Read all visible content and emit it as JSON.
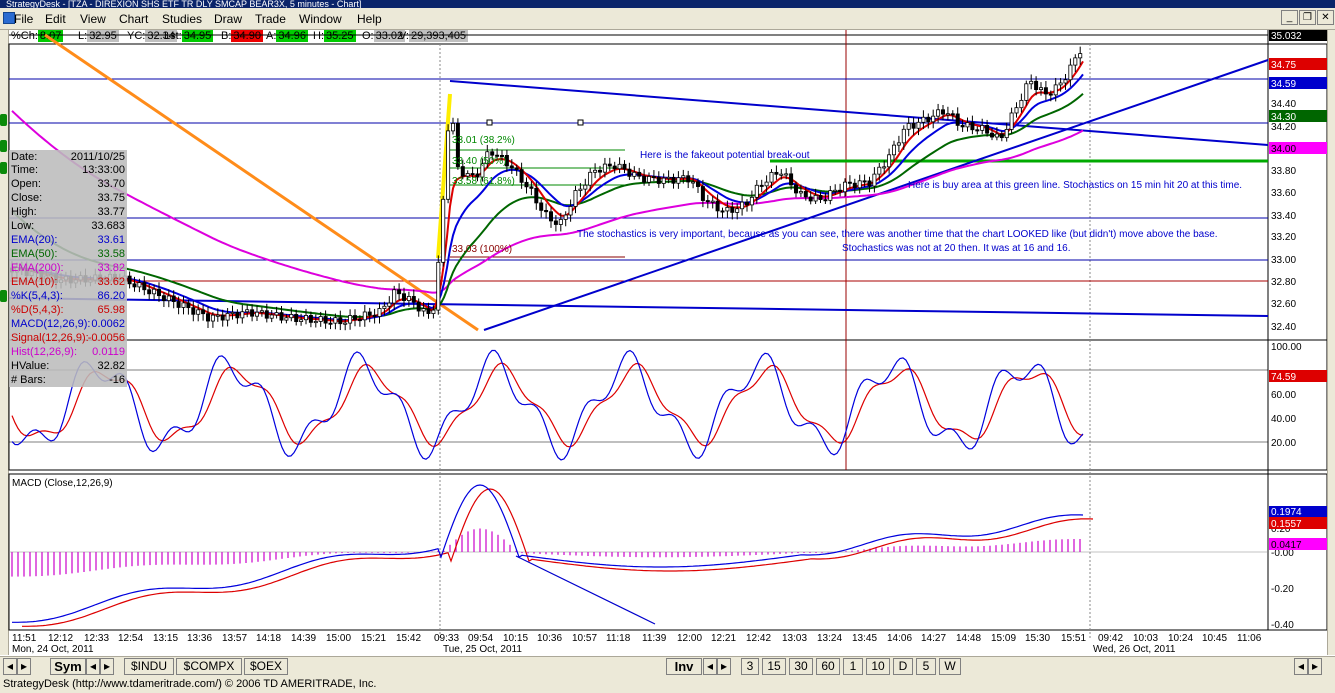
{
  "window": {
    "title": "StrategyDesk - [TZA - DIREXION SHS ETF TR DLY SMCAP BEAR3X, 5 minutes - Chart]"
  },
  "menu": [
    "File",
    "Edit",
    "View",
    "Chart",
    "Studies",
    "Draw",
    "Trade",
    "Window",
    "Help"
  ],
  "stats": [
    {
      "label": "%Ch:",
      "value": "8.07",
      "bg": "#00cc00"
    },
    {
      "label": "L:",
      "value": "32.95",
      "bg": "#c0c0c0"
    },
    {
      "label": "YC:",
      "value": "32.34",
      "bg": "#c0c0c0"
    },
    {
      "label": "Lst:",
      "value": "34.95",
      "bg": "#00cc00"
    },
    {
      "label": "B:",
      "value": "34.90",
      "bg": "#ee0000"
    },
    {
      "label": "A:",
      "value": "34.96",
      "bg": "#00cc00"
    },
    {
      "label": "H:",
      "value": "35.25",
      "bg": "#00cc00"
    },
    {
      "label": "O:",
      "value": "33.02",
      "bg": "#c0c0c0"
    },
    {
      "label": "V:",
      "value": "29,393,405",
      "bg": "#c0c0c0"
    }
  ],
  "databox": [
    {
      "label": "Date:",
      "value": "2011/10/25",
      "color": "#000000"
    },
    {
      "label": "Time:",
      "value": "13:33:00",
      "color": "#000000"
    },
    {
      "label": "Open:",
      "value": "33.70",
      "color": "#000000"
    },
    {
      "label": "Close:",
      "value": "33.75",
      "color": "#000000"
    },
    {
      "label": "High:",
      "value": "33.77",
      "color": "#000000"
    },
    {
      "label": "Low:",
      "value": "33.683",
      "color": "#000000"
    },
    {
      "label": "EMA(20):",
      "value": "33.61",
      "color": "#0000cc"
    },
    {
      "label": "EMA(50):",
      "value": "33.58",
      "color": "#006600"
    },
    {
      "label": "EMA(200):",
      "value": "33.82",
      "color": "#cc00cc"
    },
    {
      "label": "EMA(10):",
      "value": "33.62",
      "color": "#cc0000"
    },
    {
      "label": "%K(5,4,3):",
      "value": "86.20",
      "color": "#0000cc"
    },
    {
      "label": "%D(5,4,3):",
      "value": "65.98",
      "color": "#cc0000"
    },
    {
      "label": "MACD(12,26,9):",
      "value": "0.0062",
      "color": "#0000cc"
    },
    {
      "label": "Signal(12,26,9):",
      "value": "-0.0056",
      "color": "#cc0000"
    },
    {
      "label": "Hist(12,26,9):",
      "value": "0.0119",
      "color": "#cc00cc"
    },
    {
      "label": "HValue:",
      "value": "32.82",
      "color": "#000000"
    },
    {
      "label": "# Bars:",
      "value": "-16",
      "color": "#000000"
    }
  ],
  "price_axis": {
    "ticks": [
      "34.40",
      "34.20",
      "33.80",
      "33.60",
      "33.40",
      "33.20",
      "33.00",
      "32.80",
      "32.60",
      "32.40"
    ],
    "tags": [
      {
        "text": "35.032",
        "bg": "#000000",
        "fg": "#ffffff"
      },
      {
        "text": "34.75",
        "bg": "#dd0000",
        "fg": "#ffffff"
      },
      {
        "text": "34.59",
        "bg": "#0000cc",
        "fg": "#ffffff"
      },
      {
        "text": "34.30",
        "bg": "#006600",
        "fg": "#ffffff"
      },
      {
        "text": "34.00",
        "bg": "#ff00ff",
        "fg": "#000000"
      }
    ]
  },
  "stoch_axis": {
    "ticks": [
      "100.00",
      "60.00",
      "40.00",
      "20.00"
    ],
    "tag": "74.59"
  },
  "macd": {
    "title": "MACD (Close,12,26,9)",
    "ticks": [
      "0.20",
      "-0.00",
      "-0.20",
      "-0.40"
    ],
    "tags": [
      {
        "text": "0.1974",
        "bg": "#0000cc",
        "fg": "#ffffff"
      },
      {
        "text": "0.1557",
        "bg": "#dd0000",
        "fg": "#ffffff"
      },
      {
        "text": "0.0417",
        "bg": "#ff00ff",
        "fg": "#000000"
      }
    ]
  },
  "fib": [
    "33.01 (38.2%)",
    "33.40 (50%)",
    "33.58 (61.8%)",
    "33.03 (100%)"
  ],
  "annotations": [
    "Here is the fakeout potential break-out",
    "Here is buy area at this green line.  Stochastics on 15 min hit 20 at this time.",
    "The stochastics is very important, because as you can see, there was another time that the chart LOOKED like (but didn't) move above the base.",
    "Stochastics was not at 20 then.  It was at 16 and 16."
  ],
  "time_axis": {
    "labels": [
      "11:51",
      "12:12",
      "12:33",
      "12:54",
      "13:15",
      "13:36",
      "13:57",
      "14:18",
      "14:39",
      "15:00",
      "15:21",
      "15:42",
      "09:33",
      "09:54",
      "10:15",
      "10:36",
      "10:57",
      "11:18",
      "11:39",
      "12:00",
      "12:21",
      "12:42",
      "13:03",
      "13:24",
      "13:45",
      "14:06",
      "14:27",
      "14:48",
      "15:09",
      "15:30",
      "15:51",
      "09:42",
      "10:03",
      "10:24",
      "10:45",
      "11:06"
    ],
    "dates": [
      "Mon, 24 Oct, 2011",
      "Tue, 25 Oct, 2011",
      "Wed, 26 Oct, 2011"
    ]
  },
  "bottom": {
    "sym": "Sym",
    "symbols": [
      "$INDU",
      "$COMPX",
      "$OEX"
    ],
    "inv": "Inv",
    "intervals": [
      "3",
      "15",
      "30",
      "60",
      "1",
      "10",
      "D",
      "5",
      "W"
    ]
  },
  "status": "StrategyDesk (http://www.tdameritrade.com/) © 2006 TD AMERITRADE, Inc."
}
